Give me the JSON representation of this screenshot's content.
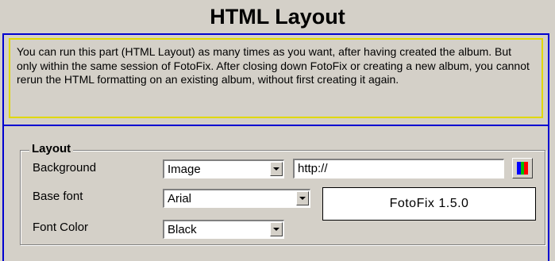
{
  "header": {
    "title": "HTML Layout"
  },
  "info": {
    "text": "You can run this part (HTML Layout) as many times as you want, after having created the album. But only within the same session of FotoFix. After closing down FotoFix or creating a new album, you cannot rerun the HTML formatting on an existing album, without first creating it again."
  },
  "layout": {
    "legend": "Layout",
    "background": {
      "label": "Background",
      "selected": "Image",
      "url_value": "http://"
    },
    "base_font": {
      "label": "Base font",
      "selected": "Arial",
      "preview_text": "FotoFix 1.5.0"
    },
    "font_color": {
      "label": "Font Color",
      "selected": "Black"
    }
  },
  "colors": {
    "frame": "#0000d0",
    "info_border": "#e0d800",
    "background": "#d4d0c8",
    "palette": [
      "#0000ff",
      "#00c000",
      "#ff0000"
    ]
  },
  "icons": {
    "color_picker": "palette-icon",
    "dropdown": "chevron-down-icon"
  }
}
